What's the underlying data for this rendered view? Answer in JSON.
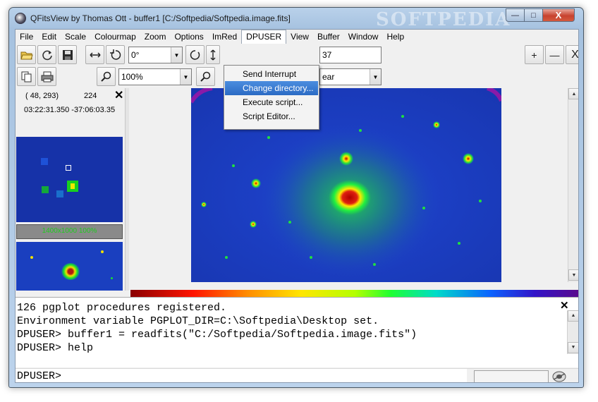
{
  "window": {
    "title": "QFitsView by Thomas Ott - buffer1 [C:/Softpedia/Softpedia.image.fits]",
    "watermark": "SOFTPEDIA",
    "controls": {
      "minimize": "—",
      "maximize": "□",
      "close": "X"
    }
  },
  "menubar": {
    "items": [
      "File",
      "Edit",
      "Scale",
      "Colourmap",
      "Zoom",
      "Options",
      "ImRed",
      "DPUSER",
      "View",
      "Buffer",
      "Window",
      "Help"
    ],
    "active": "DPUSER"
  },
  "dpuser_menu": {
    "items": [
      "Send Interrupt",
      "Change directory...",
      "Execute script...",
      "Script Editor..."
    ],
    "highlighted": "Change directory..."
  },
  "toolbar": {
    "rotation_value": "0°",
    "zoom_value": "100%",
    "value_field_partial": "37",
    "scale_combo_partial": "ear",
    "plus": "+",
    "minus": "—",
    "close": "X"
  },
  "left_panel": {
    "pixel_coords": "( 48, 293)",
    "pixel_value": "224",
    "sky_coords": "03:22:31.350 -37:06:03.35",
    "thumb_label": "1400x1000 100%"
  },
  "console": {
    "lines": [
      "126 pgplot procedures registered.",
      "Environment variable PGPLOT_DIR=C:\\Softpedia\\Desktop set.",
      "DPUSER> buffer1 = readfits(\"C:/Softpedia/Softpedia.image.fits\")",
      "DPUSER> help"
    ],
    "prompt": "DPUSER>"
  },
  "colors": {
    "image_background": "#1a3ec8",
    "menu_highlight": "#2b6bc4",
    "thumbnail_label_text": "#1fcc1f"
  }
}
